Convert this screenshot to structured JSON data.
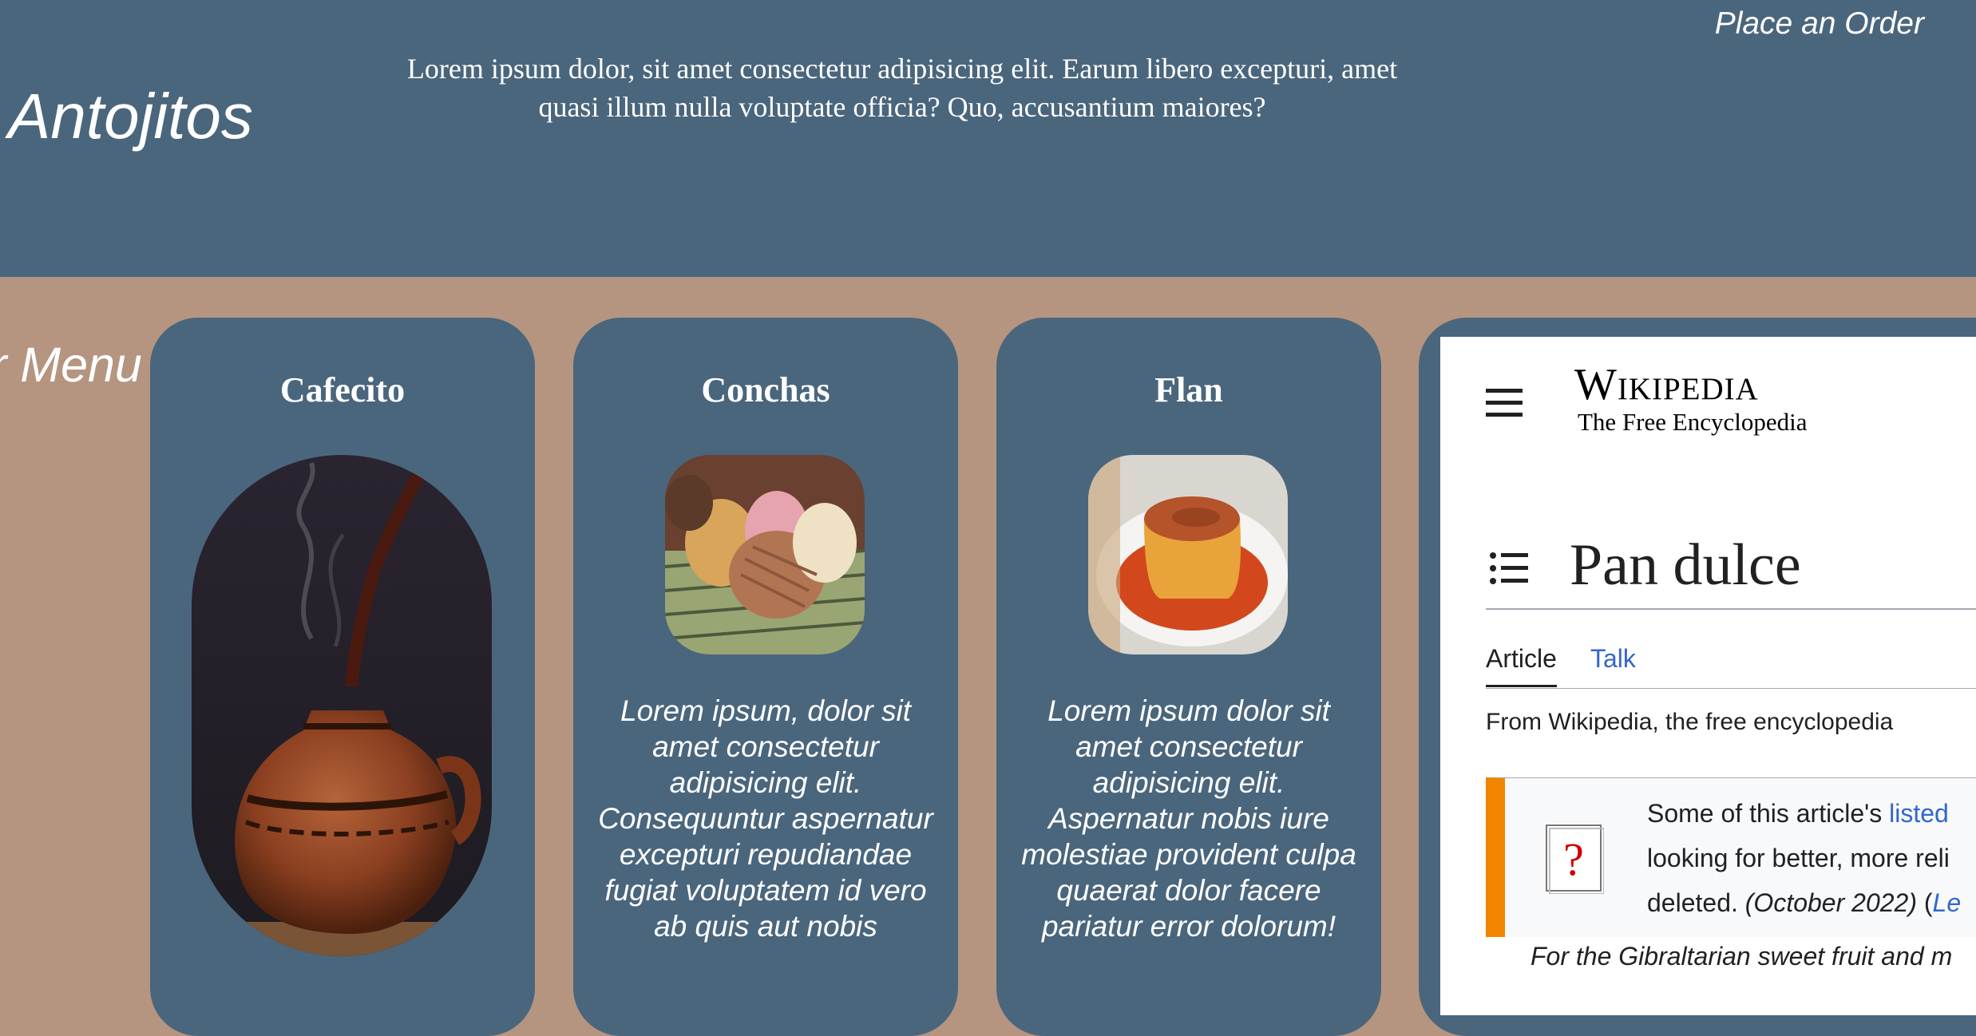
{
  "header": {
    "brand": "Antojitos",
    "tagline": "Lorem ipsum dolor, sit amet consectetur adipisicing elit. Earum libero excepturi, amet quasi illum nulla voluptate officia? Quo, accusantium maiores?",
    "order_link": "Place an Order"
  },
  "menu": {
    "label": "r Menu",
    "cards": [
      {
        "title": "Cafecito",
        "description": "",
        "image": "clay-pitcher-coffee-photo"
      },
      {
        "title": "Conchas",
        "description": "Lorem ipsum, dolor sit amet consectetur adipisicing elit. Consequuntur aspernatur excepturi repudiandae fugiat voluptatem id vero ab quis aut nobis",
        "image": "conchas-basket-photo"
      },
      {
        "title": "Flan",
        "description": "Lorem ipsum dolor sit amet consectetur adipisicing elit. Aspernatur nobis iure molestiae provident culpa quaerat dolor facere pariatur error dolorum!",
        "image": "flan-plate-photo"
      }
    ]
  },
  "wiki": {
    "wordmark_title": "Wikipedia",
    "wordmark_subtitle": "The Free Encyclopedia",
    "article_title": "Pan dulce",
    "tab_article": "Article",
    "tab_talk": "Talk",
    "from_wikipedia": "From Wikipedia, the free encyclopedia",
    "notice_line1_prefix": "Some of this article's ",
    "notice_line1_link": "listed",
    "notice_line2": "looking for better, more reli",
    "notice_line3_prefix": "deleted. ",
    "notice_line3_date": "(October 2022)",
    "notice_line3_paren": " (",
    "notice_line3_link": "Le",
    "hatnote": "For the Gibraltarian sweet fruit and m"
  },
  "colors": {
    "page_background": "#b59580",
    "header_background": "#4a667d",
    "card_background": "#4a667d",
    "wiki_link": "#3366cc",
    "notice_bar": "#f28500"
  }
}
